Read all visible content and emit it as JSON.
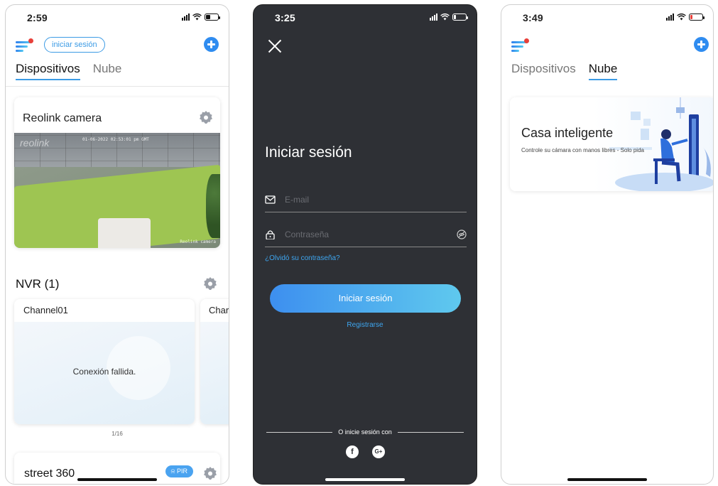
{
  "screen1": {
    "status_time": "2:59",
    "login_pill": "iniciar sesión",
    "tabs": [
      {
        "label": "Dispositivos",
        "active": true
      },
      {
        "label": "Nube",
        "active": false
      }
    ],
    "camera_card": {
      "title": "Reolink camera",
      "overlay_logo": "reolink",
      "overlay_timestamp": "01-06-2022 02:53:01 pm GMT",
      "overlay_name": "Reolink camera"
    },
    "nvr": {
      "title": "NVR (1)",
      "channels": [
        {
          "label": "Channel01",
          "status": "Conexión fallida."
        },
        {
          "label": "Char"
        }
      ],
      "pager": "1/16"
    },
    "street": {
      "title": "street 360",
      "badge": "PIR"
    },
    "icons": [
      "menu-icon",
      "add-icon",
      "gear-icon",
      "bell-icon"
    ]
  },
  "screen2": {
    "status_time": "3:25",
    "title": "Iniciar sesión",
    "email_placeholder": "E-mail",
    "password_placeholder": "Contraseña",
    "forgot_link": "¿Olvidó su contraseña?",
    "login_button": "Iniciar sesión",
    "register_link": "Registrarse",
    "or_text": "O inicie sesión con",
    "social": [
      {
        "name": "facebook",
        "glyph": "f"
      },
      {
        "name": "google",
        "glyph": "G+"
      }
    ],
    "icons": [
      "close-icon",
      "mail-icon",
      "lock-icon",
      "eye-off-icon"
    ]
  },
  "screen3": {
    "status_time": "3:49",
    "tabs": [
      {
        "label": "Dispositivos",
        "active": false
      },
      {
        "label": "Nube",
        "active": true
      }
    ],
    "smart_home": {
      "title": "Casa inteligente",
      "subtitle": "Controle su cámara con manos libres - Solo pida"
    }
  },
  "colors": {
    "accent": "#3c9be5",
    "dark_bg": "#2e3035",
    "alert": "#e8403a"
  }
}
